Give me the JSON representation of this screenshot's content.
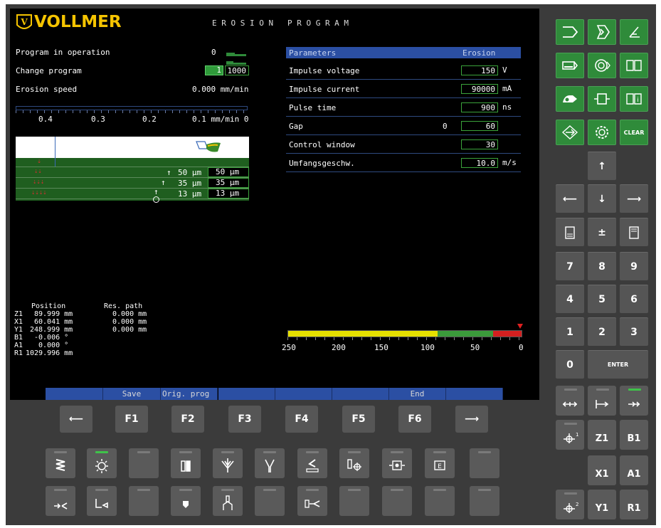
{
  "screen": {
    "brand": "VOLLMER",
    "title": "E R O S I O N   P R O G R A M",
    "left": {
      "program_in_operation_label": "Program in operation",
      "program_in_operation_value": "0",
      "change_program_label": "Change program",
      "change_program_num": "1",
      "change_program_value": "1000",
      "erosion_speed_label": "Erosion speed",
      "erosion_speed_value": "0.000 mm/min",
      "scale_labels": [
        "0.4",
        "0.3",
        "0.2",
        "0.1 mm/min 0"
      ]
    },
    "passes": [
      {
        "value": "50 µm",
        "set": "50 µm"
      },
      {
        "value": "35 µm",
        "set": "35 µm"
      },
      {
        "value": "13 µm",
        "set": "13 µm"
      }
    ],
    "parameters": {
      "header_label": "Parameters",
      "header_value": "Erosion",
      "rows": [
        {
          "label": "Impulse voltage",
          "value": "150",
          "unit": "V"
        },
        {
          "label": "Impulse current",
          "value": "90000",
          "unit": "mA"
        },
        {
          "label": "Pulse time",
          "value": "900",
          "unit": "ns"
        },
        {
          "label": "Gap",
          "extra": "0",
          "value": "60",
          "unit": ""
        },
        {
          "label": "Control window",
          "value": "30",
          "unit": ""
        },
        {
          "label": "Umfangsgeschw.",
          "value": "10.0",
          "unit": "m/s"
        }
      ]
    },
    "position": {
      "header_pos": "Position",
      "header_res": "Res. path",
      "rows": [
        {
          "axis": "Z1",
          "pos": "89.999 mm",
          "res": "0.000 mm"
        },
        {
          "axis": "X1",
          "pos": "60.041 mm",
          "res": "0.000 mm"
        },
        {
          "axis": "Y1",
          "pos": "248.999 mm",
          "res": "0.000 mm"
        },
        {
          "axis": "B1",
          "pos": "-0.006 °",
          "res": ""
        },
        {
          "axis": "A1",
          "pos": "0.000 °",
          "res": ""
        },
        {
          "axis": "R1",
          "pos": "1029.996 mm",
          "res": ""
        }
      ]
    },
    "gauge_labels": [
      "250",
      "200",
      "150",
      "100",
      "50",
      "0"
    ],
    "softkeys": [
      "",
      "Save",
      "Orig. prog",
      "",
      "",
      "",
      "End",
      "",
      ""
    ]
  },
  "fkeys": [
    "F1",
    "F2",
    "F3",
    "F4",
    "F5",
    "F6"
  ],
  "keypad": {
    "clear": "CLEAR",
    "plusminus": "±",
    "digits": [
      "7",
      "8",
      "9",
      "4",
      "5",
      "6",
      "1",
      "2",
      "3",
      "0"
    ],
    "enter": "ENTER"
  },
  "axiskeys": [
    "Z1",
    "B1",
    "X1",
    "A1",
    "Y1",
    "R1"
  ],
  "colors": {
    "accent_green": "#2f8b3a",
    "softkey_blue": "#2b4fa3",
    "param_header": "#2b4fa3"
  }
}
